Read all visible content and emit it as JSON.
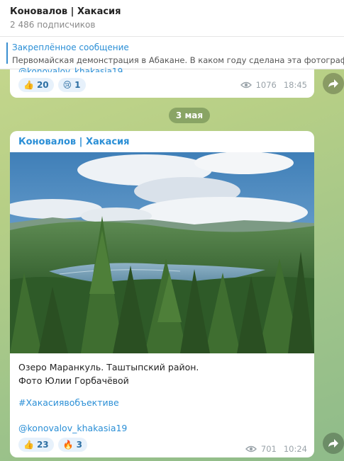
{
  "header": {
    "title": "Коновалов | Хакасия",
    "subscribers": "2 486 подписчиков"
  },
  "pinned": {
    "title": "Закреплённое сообщение",
    "text": "Первомайская демонстрация в Абакане. В каком году сделана эта фотограф"
  },
  "prev_message": {
    "cut_text": "@konovalov_khakasia19",
    "reactions": [
      {
        "emoji": "👍",
        "count": "20"
      },
      {
        "emoji": "😢",
        "count": "1"
      }
    ],
    "views": "1076",
    "time": "18:45"
  },
  "date_separator": "3 мая",
  "post": {
    "author": "Коновалов | Хакасия",
    "caption_line1": "Озеро Маранкуль. Таштыпский район.",
    "caption_line2": "Фото Юлии Горбачёвой",
    "hashtag": "#Хакасиявобъективе",
    "handle": "@konovalov_khakasia19",
    "reactions": [
      {
        "emoji": "👍",
        "count": "23"
      },
      {
        "emoji": "🔥",
        "count": "3"
      }
    ],
    "views": "701",
    "time": "10:24"
  },
  "icons": {
    "eye": "eye-icon",
    "share": "share-arrow-icon"
  }
}
